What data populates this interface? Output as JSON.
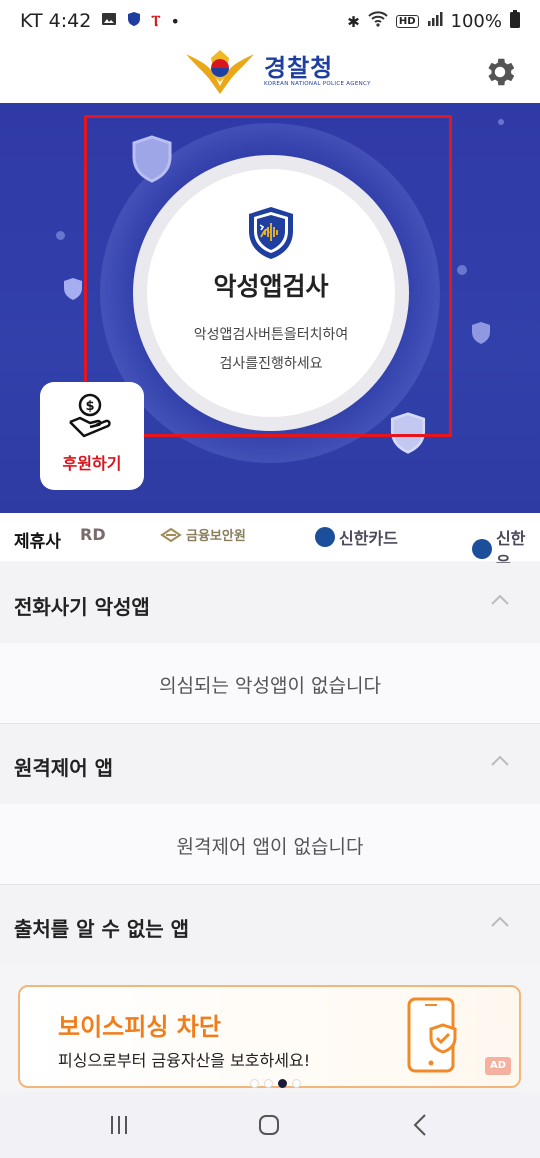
{
  "status_bar": {
    "carrier_time": "KT 4:42",
    "battery": "100%",
    "icons_left": [
      "image-icon",
      "shield-app-icon",
      "t-app-icon",
      "dot-icon"
    ],
    "icons_right": [
      "bluetooth-icon",
      "wifi-icon",
      "hd-icon",
      "signal-icon",
      "battery-icon"
    ]
  },
  "header": {
    "logo_ko": "경찰청",
    "logo_en": "KOREAN NATIONAL POLICE AGENCY",
    "settings_icon": "gear-icon"
  },
  "hero": {
    "scan_title": "악성앱검사",
    "scan_line1": "악성앱검사버튼을터치하여",
    "scan_line2": "검사를진행하세요",
    "donate_label": "후원하기",
    "colors": {
      "background": "#3240ab",
      "highlight": "#e8141c"
    }
  },
  "partners": {
    "label": "제휴사",
    "items": [
      {
        "name": "RD"
      },
      {
        "name": "금융보안원"
      },
      {
        "name": "신한카드"
      },
      {
        "name": "신한은"
      }
    ]
  },
  "sections": [
    {
      "title": "전화사기 악성앱",
      "message": "의심되는 악성앱이 없습니다"
    },
    {
      "title": "원격제어 앱",
      "message": "원격제어 앱이 없습니다"
    },
    {
      "title": "출처를 알 수 없는 앱",
      "message": ""
    }
  ],
  "banner": {
    "title": "보이스피싱 차단",
    "subtitle": "피싱으로부터 금융자산을 보호하세요!",
    "ad_label": "AD",
    "colors": {
      "accent": "#f07d1a"
    }
  },
  "pager": {
    "count": 4,
    "active_index": 2
  }
}
